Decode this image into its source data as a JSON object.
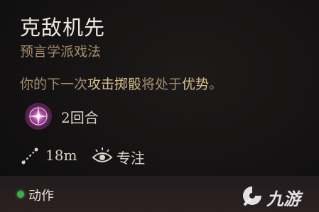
{
  "spell": {
    "title": "克敌机先",
    "school": "预言学派戏法",
    "description": {
      "part1": "你的下一次",
      "highlight1": "攻击掷骰",
      "part2": "将处于",
      "highlight2": "优势",
      "part3": "。"
    },
    "duration": "2回合",
    "range": "18m",
    "concentration": "专注"
  },
  "footer": {
    "action_label": "动作"
  },
  "watermark": {
    "text": "九游"
  },
  "icons": {
    "spell": "divination-spell-icon",
    "range": "range-icon",
    "concentration": "concentration-eye-icon",
    "action_indicator": "action-dot-icon",
    "watermark_logo": "jiuyou-logo-icon"
  },
  "colors": {
    "background": "#141212",
    "title": "#efe9e2",
    "school": "#a48c6f",
    "highlight": "#d8bf8c",
    "action_dot": "#3fae4a",
    "footer_bg": "#2b2022"
  }
}
